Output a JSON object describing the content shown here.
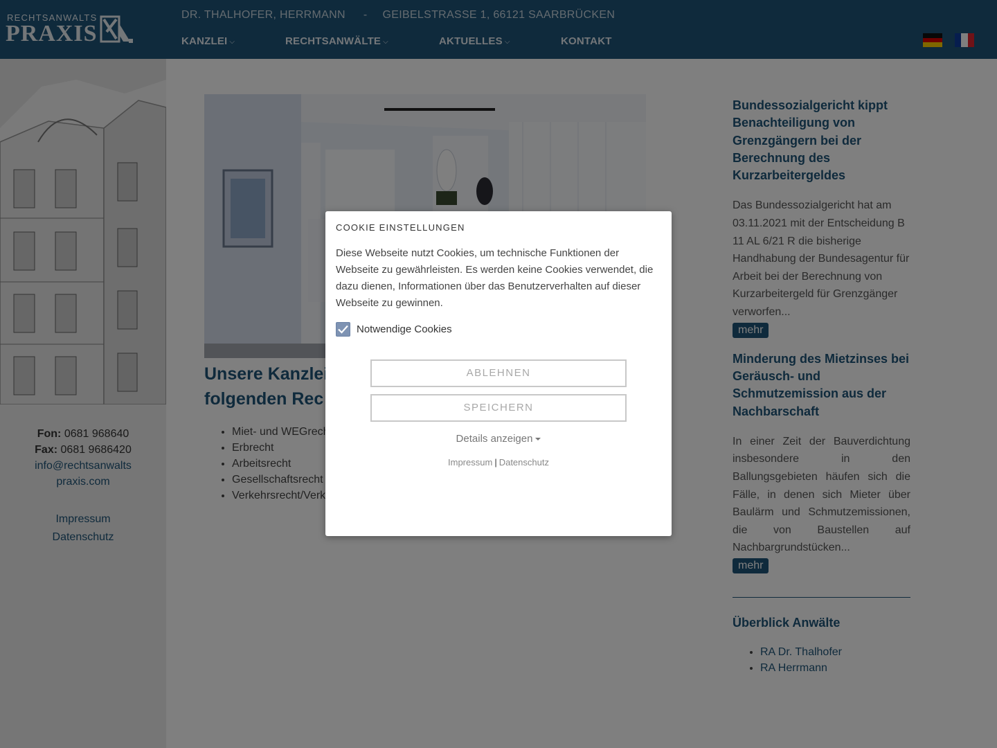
{
  "header": {
    "logo_small": "RECHTSANWALTS",
    "logo_big": "PRAXIS",
    "firm_names": "DR. THALHOFER, HERRMANN",
    "separator": "-",
    "address": "GEIBELSTRASSE 1, 66121 SAARBRÜCKEN",
    "nav": [
      {
        "label": "KANZLEI",
        "has_dropdown": true
      },
      {
        "label": "RECHTSANWÄLTE",
        "has_dropdown": true
      },
      {
        "label": "AKTUELLES",
        "has_dropdown": true
      },
      {
        "label": "KONTAKT",
        "has_dropdown": false
      }
    ],
    "chevron": "⌵",
    "languages": [
      "german-flag-icon",
      "french-flag-icon"
    ]
  },
  "sidebar": {
    "fon_label": "Fon:",
    "fon_value": "0681 968640",
    "fax_label": "Fax:",
    "fax_value": "0681 9686420",
    "email_line1": "info@rechtsanwalts",
    "email_line2": "praxis.com",
    "impressum": "Impressum",
    "datenschutz": "Datenschutz"
  },
  "main": {
    "heading_line1": "Unsere Kanzlei",
    "heading_line2": "folgenden Rec",
    "practice_areas": [
      "Miet- und WEGrech",
      "Erbrecht",
      "Arbeitsrecht",
      "Gesellschaftsrecht",
      "Verkehrsrecht/Verk"
    ]
  },
  "news": [
    {
      "title": "Bundessozialgericht kippt Benachteiligung von Grenzgängern bei der Berechnung des Kurzarbeitergeldes",
      "text": "Das Bundessozialgericht hat am 03.11.2021 mit der Entscheidung B 11 AL 6/21 R die bisherige Handhabung der Bundesagentur für Arbeit bei der Berechnung von Kurzarbeitergeld für Grenzgänger verworfen...",
      "more": "mehr"
    },
    {
      "title": "Minderung des Mietzinses bei Geräusch- und Schmutzemission aus der Nachbarschaft",
      "text": "In einer Zeit der Bauverdichtung insbesondere in den Ballungsgebieten häufen sich die Fälle, in denen sich Mieter über Baulärm und Schmutzemissionen, die von Baustellen auf Nachbargrundstücken...",
      "more": "mehr"
    }
  ],
  "lawyers": {
    "title": "Überblick Anwälte",
    "items": [
      "RA Dr. Thalhofer",
      "RA Herrmann"
    ]
  },
  "cookie_modal": {
    "title": "COOKIE EINSTELLUNGEN",
    "text": "Diese Webseite nutzt Cookies, um technische Funktionen der Webseite zu gewährleisten. Es werden keine Cookies verwendet, die dazu dienen, Informationen über das Benutzerverhalten auf dieser Webseite zu gewinnen.",
    "checkbox_label": "Notwendige Cookies",
    "checkbox_checked": true,
    "reject_button": "ABLEHNEN",
    "save_button": "SPEICHERN",
    "details_link": "Details anzeigen",
    "impressum_link": "Impressum",
    "link_separator": "|",
    "datenschutz_link": "Datenschutz"
  },
  "colors": {
    "brand_blue": "#1e5478",
    "overlay": "rgba(0,0,0,0.5)"
  }
}
